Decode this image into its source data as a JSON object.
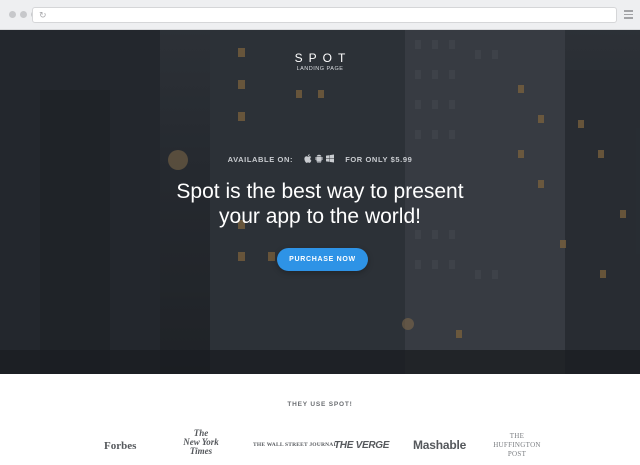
{
  "browser": {
    "window_controls": [
      "close",
      "minimize",
      "maximize"
    ],
    "reload_icon": "reload-icon",
    "menu_icon": "hamburger-menu-icon"
  },
  "hero": {
    "brand": {
      "name": "SPOT",
      "tagline": "LANDING PAGE"
    },
    "availability": {
      "prefix": "AVAILABLE ON:",
      "platforms": [
        "apple-icon",
        "android-icon",
        "windows-icon"
      ],
      "price_text": "FOR ONLY $5.99"
    },
    "headline_line1": "Spot is the best way to present",
    "headline_line2": "your app to the world!",
    "cta_label": "PURCHASE NOW",
    "colors": {
      "accent": "#2e93e6",
      "overlay": "#2f343a"
    }
  },
  "press": {
    "title": "THEY USE SPOT!",
    "logos": {
      "forbes": "Forbes",
      "nyt_line1": "The",
      "nyt_line2": "New York",
      "nyt_line3": "Times",
      "wsj": "THE WALL STREET JOURNAL",
      "verge": "THE VERGE",
      "mashable": "Mashable",
      "huff_line1": "THE",
      "huff_line2": "HUFFINGTON",
      "huff_line3": "POST"
    }
  }
}
